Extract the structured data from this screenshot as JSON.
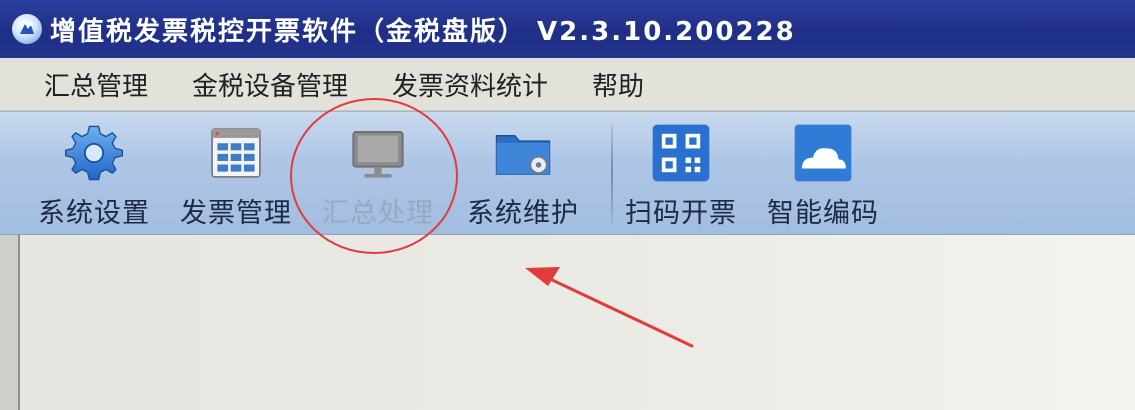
{
  "window": {
    "title": "增值税发票税控开票软件（金税盘版） V2.3.10.200228"
  },
  "menu": {
    "items": [
      "汇总管理",
      "金税设备管理",
      "发票资料统计",
      "帮助"
    ]
  },
  "toolbar": {
    "system_settings": "系统设置",
    "invoice_management": "发票管理",
    "summary_processing": "汇总处理",
    "system_maintenance": "系统维护",
    "scan_invoice": "扫码开票",
    "smart_coding": "智能编码"
  },
  "icons": {
    "app": "app-logo-icon",
    "system_settings": "gear-icon",
    "invoice_management": "grid-window-icon",
    "summary_processing": "monitor-icon",
    "system_maintenance": "folder-gear-icon",
    "scan_invoice": "qr-code-icon",
    "smart_coding": "cloud-icon"
  },
  "colors": {
    "title_bar": "#22348f",
    "toolbar": "#aec6e6",
    "annotation": "#e23b3b"
  },
  "annotation": {
    "highlight_target": "summary_processing"
  }
}
